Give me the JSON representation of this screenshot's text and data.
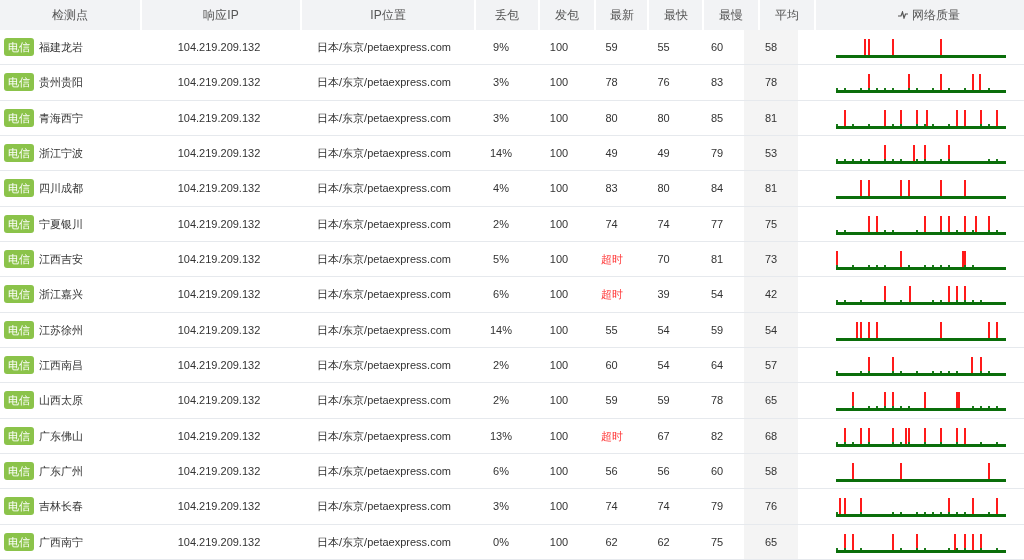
{
  "table": {
    "columns": [
      "检测点",
      "响应IP",
      "IP位置",
      "丢包",
      "发包",
      "最新",
      "最快",
      "最慢",
      "平均",
      "网络质量"
    ],
    "rows": [
      {
        "isp": "电信",
        "location": "福建龙岩",
        "ip": "104.219.209.132",
        "ip_location": "日本/东京/petaexpress.com",
        "loss": "9%",
        "sent": "100",
        "latest": "59",
        "latest_timeout": false,
        "fastest": "55",
        "slowest": "60",
        "average": "58"
      },
      {
        "isp": "电信",
        "location": "贵州贵阳",
        "ip": "104.219.209.132",
        "ip_location": "日本/东京/petaexpress.com",
        "loss": "3%",
        "sent": "100",
        "latest": "78",
        "latest_timeout": false,
        "fastest": "76",
        "slowest": "83",
        "average": "78"
      },
      {
        "isp": "电信",
        "location": "青海西宁",
        "ip": "104.219.209.132",
        "ip_location": "日本/东京/petaexpress.com",
        "loss": "3%",
        "sent": "100",
        "latest": "80",
        "latest_timeout": false,
        "fastest": "80",
        "slowest": "85",
        "average": "81"
      },
      {
        "isp": "电信",
        "location": "浙江宁波",
        "ip": "104.219.209.132",
        "ip_location": "日本/东京/petaexpress.com",
        "loss": "14%",
        "sent": "100",
        "latest": "49",
        "latest_timeout": false,
        "fastest": "49",
        "slowest": "79",
        "average": "53"
      },
      {
        "isp": "电信",
        "location": "四川成都",
        "ip": "104.219.209.132",
        "ip_location": "日本/东京/petaexpress.com",
        "loss": "4%",
        "sent": "100",
        "latest": "83",
        "latest_timeout": false,
        "fastest": "80",
        "slowest": "84",
        "average": "81"
      },
      {
        "isp": "电信",
        "location": "宁夏银川",
        "ip": "104.219.209.132",
        "ip_location": "日本/东京/petaexpress.com",
        "loss": "2%",
        "sent": "100",
        "latest": "74",
        "latest_timeout": false,
        "fastest": "74",
        "slowest": "77",
        "average": "75"
      },
      {
        "isp": "电信",
        "location": "江西吉安",
        "ip": "104.219.209.132",
        "ip_location": "日本/东京/petaexpress.com",
        "loss": "5%",
        "sent": "100",
        "latest": "超时",
        "latest_timeout": true,
        "fastest": "70",
        "slowest": "81",
        "average": "73"
      },
      {
        "isp": "电信",
        "location": "浙江嘉兴",
        "ip": "104.219.209.132",
        "ip_location": "日本/东京/petaexpress.com",
        "loss": "6%",
        "sent": "100",
        "latest": "超时",
        "latest_timeout": true,
        "fastest": "39",
        "slowest": "54",
        "average": "42"
      },
      {
        "isp": "电信",
        "location": "江苏徐州",
        "ip": "104.219.209.132",
        "ip_location": "日本/东京/petaexpress.com",
        "loss": "14%",
        "sent": "100",
        "latest": "55",
        "latest_timeout": false,
        "fastest": "54",
        "slowest": "59",
        "average": "54"
      },
      {
        "isp": "电信",
        "location": "江西南昌",
        "ip": "104.219.209.132",
        "ip_location": "日本/东京/petaexpress.com",
        "loss": "2%",
        "sent": "100",
        "latest": "60",
        "latest_timeout": false,
        "fastest": "54",
        "slowest": "64",
        "average": "57"
      },
      {
        "isp": "电信",
        "location": "山西太原",
        "ip": "104.219.209.132",
        "ip_location": "日本/东京/petaexpress.com",
        "loss": "2%",
        "sent": "100",
        "latest": "59",
        "latest_timeout": false,
        "fastest": "59",
        "slowest": "78",
        "average": "65"
      },
      {
        "isp": "电信",
        "location": "广东佛山",
        "ip": "104.219.209.132",
        "ip_location": "日本/东京/petaexpress.com",
        "loss": "13%",
        "sent": "100",
        "latest": "超时",
        "latest_timeout": true,
        "fastest": "67",
        "slowest": "82",
        "average": "68"
      },
      {
        "isp": "电信",
        "location": "广东广州",
        "ip": "104.219.209.132",
        "ip_location": "日本/东京/petaexpress.com",
        "loss": "6%",
        "sent": "100",
        "latest": "56",
        "latest_timeout": false,
        "fastest": "56",
        "slowest": "60",
        "average": "58"
      },
      {
        "isp": "电信",
        "location": "吉林长春",
        "ip": "104.219.209.132",
        "ip_location": "日本/东京/petaexpress.com",
        "loss": "3%",
        "sent": "100",
        "latest": "74",
        "latest_timeout": false,
        "fastest": "74",
        "slowest": "79",
        "average": "76"
      },
      {
        "isp": "电信",
        "location": "广西南宁",
        "ip": "104.219.209.132",
        "ip_location": "日本/东京/petaexpress.com",
        "loss": "0%",
        "sent": "100",
        "latest": "62",
        "latest_timeout": false,
        "fastest": "62",
        "slowest": "75",
        "average": "65"
      }
    ]
  }
}
